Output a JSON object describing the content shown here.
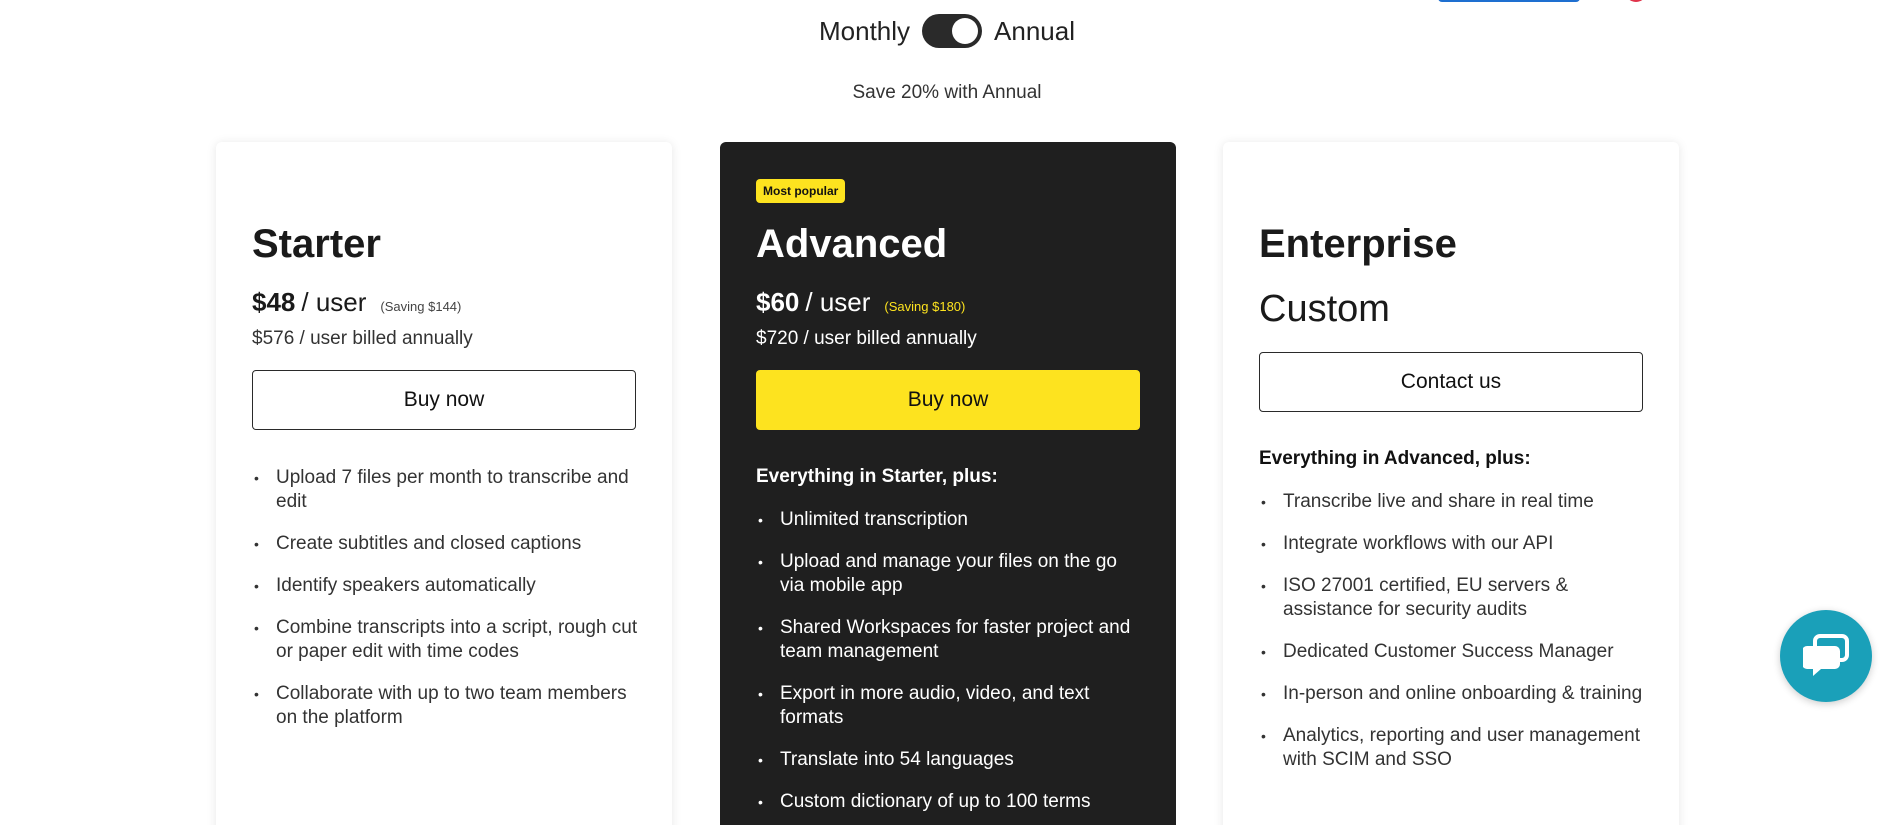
{
  "billing": {
    "monthly_label": "Monthly",
    "annual_label": "Annual",
    "toggle_state": "annual",
    "save_note": "Save 20% with Annual"
  },
  "plans": [
    {
      "name": "Starter",
      "price": "$48",
      "per": "/ user",
      "saving": "(Saving $144)",
      "billed": "$576 / user billed annually",
      "button": "Buy now",
      "features": [
        "Upload 7 files per month to transcribe and edit",
        "Create subtitles and closed captions",
        "Identify speakers automatically",
        "Combine transcripts into a script, rough cut or paper edit with time codes",
        "Collaborate with up to two team members on the platform"
      ]
    },
    {
      "badge": "Most popular",
      "name": "Advanced",
      "price": "$60",
      "per": "/ user",
      "saving": "(Saving $180)",
      "billed": "$720 / user billed annually",
      "button": "Buy now",
      "features_heading": "Everything in Starter, plus:",
      "features": [
        "Unlimited transcription",
        "Upload and manage your files on the go via mobile app",
        "Shared Workspaces for faster project and team management",
        "Export in more audio, video, and text formats",
        "Translate into 54 languages",
        "Custom dictionary of up to 100 terms"
      ]
    },
    {
      "name": "Enterprise",
      "price_text": "Custom",
      "button": "Contact us",
      "features_heading": "Everything in Advanced, plus:",
      "features": [
        "Transcribe live and share in real time",
        "Integrate workflows with our API",
        "ISO 27001 certified, EU servers & assistance for security audits",
        "Dedicated Customer Success Manager",
        "In-person and online onboarding & training",
        "Analytics, reporting and user management with SCIM and SSO"
      ]
    }
  ],
  "colors": {
    "accent_yellow": "#fde31f",
    "dark_card": "#1f1f1f",
    "chat_teal": "#1aa0b9"
  },
  "icons": {
    "chat": "chat-bubble-icon"
  }
}
